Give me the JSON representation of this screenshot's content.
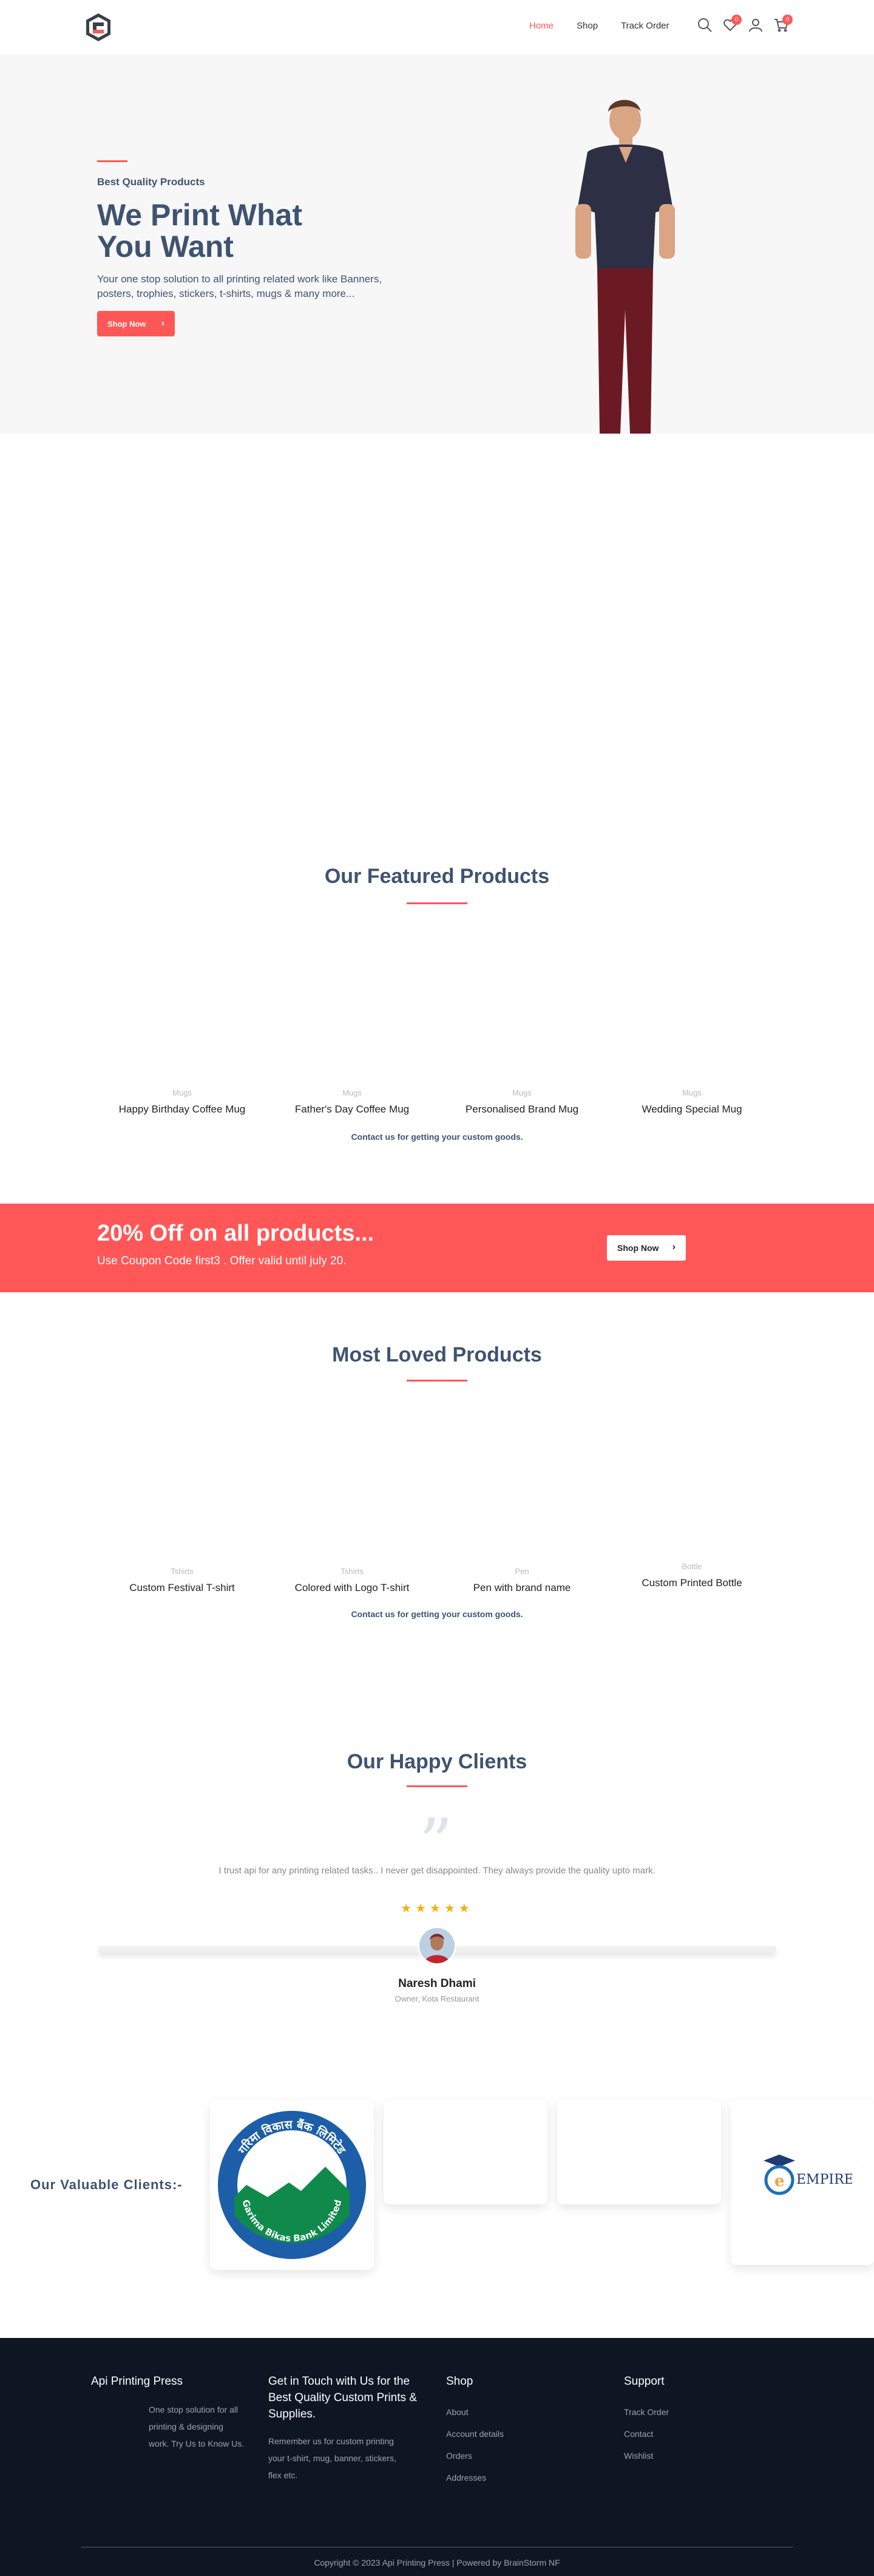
{
  "header": {
    "nav": [
      {
        "label": "Home",
        "active": true
      },
      {
        "label": "Shop",
        "active": false
      },
      {
        "label": "Track Order",
        "active": false
      }
    ],
    "wishlist_count": "0",
    "cart_count": "0"
  },
  "hero": {
    "eyebrow": "Best Quality Products",
    "title": "We Print What You Want",
    "description": "Your one stop solution to all printing related work like Banners, posters, trophies, stickers, t-shirts, mugs & many more...",
    "button_label": "Shop Now"
  },
  "featured": {
    "title": "Our Featured Products",
    "products": [
      {
        "category": "Mugs",
        "name": "Happy Birthday Coffee Mug"
      },
      {
        "category": "Mugs",
        "name": "Father's Day Coffee Mug"
      },
      {
        "category": "Mugs",
        "name": "Personalised Brand Mug"
      },
      {
        "category": "Mugs",
        "name": "Wedding Special Mug"
      }
    ],
    "contact_text": "Contact us for getting your custom goods."
  },
  "promo": {
    "title": "20% Off on all products...",
    "subtitle": "Use Coupon Code first3 . Offer valid until july 20.",
    "button_label": "Shop Now"
  },
  "loved": {
    "title": "Most Loved Products",
    "products": [
      {
        "category": "Tshirts",
        "name": "Custom Festival T-shirt"
      },
      {
        "category": "Tshirts",
        "name": "Colored with Logo T-shirt"
      },
      {
        "category": "Pen",
        "name": "Pen with brand name"
      },
      {
        "category": "Bottle",
        "name": "Custom Printed Bottle"
      }
    ],
    "contact_text": "Contact us for getting your custom goods."
  },
  "clients": {
    "title": "Our Happy Clients",
    "quote": "I trust api for any printing related tasks.. I never get disappointed. They always provide the quality upto mark.",
    "stars": "★★★★★",
    "rating": 5,
    "name": "Naresh Dhami",
    "role": "Owner, Kota Restaurant"
  },
  "valuable": {
    "title": "Our Valuable Clients:-",
    "logo1_text_top": "गरिमा विकास बैंक लिमिटेड",
    "logo1_text_bottom": "Garima Bikas Bank Limited",
    "logo2_text": "EMPIRE"
  },
  "footer": {
    "brand": "Api Printing Press",
    "brand_desc": [
      "One stop solution for all",
      "printing & designing",
      "work. Try Us to Know Us."
    ],
    "contact_title": [
      "Get in Touch with Us for the",
      "Best Quality Custom Prints &",
      "Supplies."
    ],
    "contact_desc": [
      "Remember us for custom printing",
      "your t-shirt, mug, banner, stickers,",
      "flex etc."
    ],
    "shop_title": "Shop",
    "shop_links": [
      "About",
      "Account details",
      "Orders",
      "Addresses"
    ],
    "support_title": "Support",
    "support_links": [
      "Track Order",
      "Contact",
      "Wishlist"
    ],
    "copyright": "Copyright © 2023 Api Printing Press | Powered by BrainStorm NF"
  },
  "colors": {
    "accent": "#ff5757",
    "heading": "#3f5370",
    "footer_bg": "#0e1624"
  }
}
